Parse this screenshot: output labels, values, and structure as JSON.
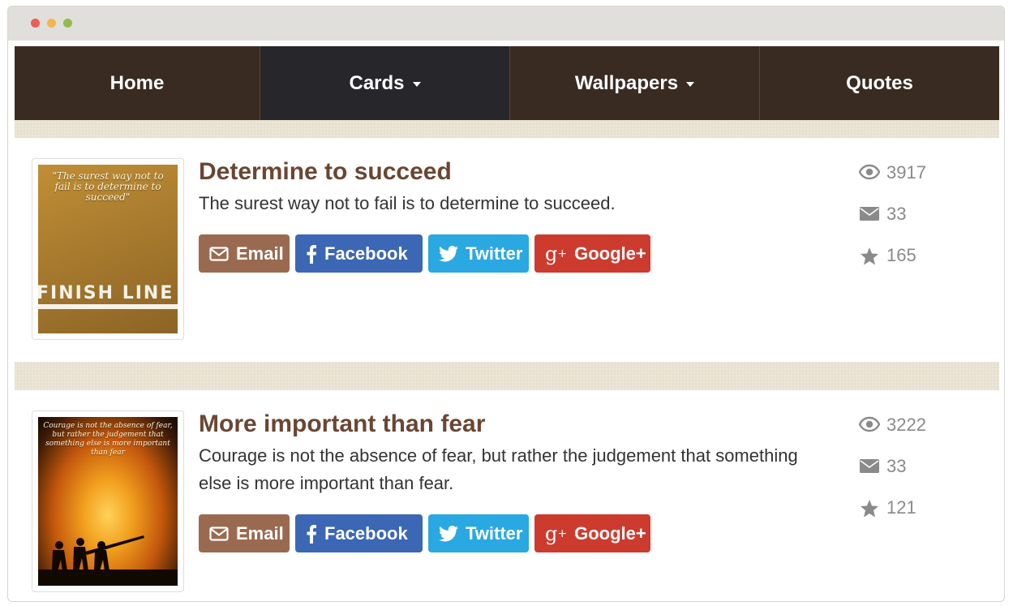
{
  "window": {
    "controls": [
      "close",
      "minimize",
      "zoom"
    ]
  },
  "nav": {
    "items": [
      {
        "label": "Home",
        "dropdown": false
      },
      {
        "label": "Cards",
        "dropdown": true
      },
      {
        "label": "Wallpapers",
        "dropdown": true
      },
      {
        "label": "Quotes",
        "dropdown": false
      }
    ]
  },
  "cards": [
    {
      "title": "Determine to succeed",
      "description": "The surest way not to fail is to determine to succeed.",
      "image": {
        "overlay_text": "\"The surest way not to fail is to determine to succeed\"",
        "sign_text": "FINISH LINE"
      },
      "buttons": {
        "email": "Email",
        "facebook": "Facebook",
        "twitter": "Twitter",
        "google": "Google+"
      },
      "stats": {
        "views": "3917",
        "emails": "33",
        "stars": "165"
      }
    },
    {
      "title": "More important than fear",
      "description": "Courage is not the absence of fear, but rather the judgement that something else is more important than fear.",
      "image": {
        "overlay_text": "Courage is not the absence of fear, but rather the judgement that something else is more important than fear"
      },
      "buttons": {
        "email": "Email",
        "facebook": "Facebook",
        "twitter": "Twitter",
        "google": "Google+"
      },
      "stats": {
        "views": "3222",
        "emails": "33",
        "stars": "121"
      }
    }
  ],
  "colors": {
    "nav_bg": "#3a2b22",
    "nav_active": "#27262a",
    "title": "#6a4632",
    "email_btn": "#9a6a50",
    "facebook_btn": "#3b67b5",
    "twitter_btn": "#2aa8e2",
    "google_btn": "#cd3b2f"
  },
  "icons": [
    "envelope-icon",
    "facebook-icon",
    "twitter-icon",
    "google-plus-icon",
    "eye-icon",
    "star-icon"
  ]
}
